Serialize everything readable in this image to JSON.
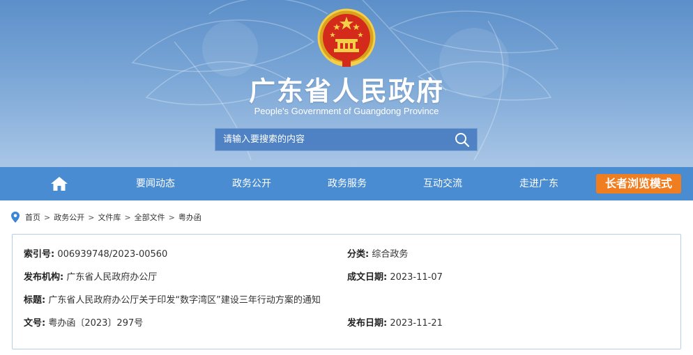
{
  "header": {
    "title": "广东省人民政府",
    "subtitle": "People's Government of Guangdong Province",
    "emblem_icon": "national-emblem-icon",
    "search_placeholder": "请输入要搜索的内容",
    "search_icon": "search-icon"
  },
  "nav": {
    "home_icon": "home-icon",
    "items": [
      {
        "label": "要闻动态"
      },
      {
        "label": "政务公开"
      },
      {
        "label": "政务服务"
      },
      {
        "label": "互动交流"
      },
      {
        "label": "走进广东"
      }
    ],
    "elder_mode_label": "长者浏览模式",
    "elder_mode_color": "#f07d20",
    "bar_color": "#4a8cd2"
  },
  "breadcrumb": {
    "pin_icon": "location-pin-icon",
    "items": [
      "首页",
      "政务公开",
      "文件库",
      "全部文件",
      "粤办函"
    ],
    "separator": ">"
  },
  "document_info": {
    "index_no": {
      "label": "索引号:",
      "value": "006939748/2023-00560"
    },
    "category": {
      "label": "分类:",
      "value": "综合政务"
    },
    "publisher": {
      "label": "发布机构:",
      "value": "广东省人民政府办公厅"
    },
    "created_date": {
      "label": "成文日期:",
      "value": "2023-11-07"
    },
    "title": {
      "label": "标题:",
      "value": "广东省人民政府办公厅关于印发“数字湾区”建设三年行动方案的通知"
    },
    "doc_no": {
      "label": "文号:",
      "value": "粤办函〔2023〕297号"
    },
    "published_date": {
      "label": "发布日期:",
      "value": "2023-11-21"
    }
  }
}
